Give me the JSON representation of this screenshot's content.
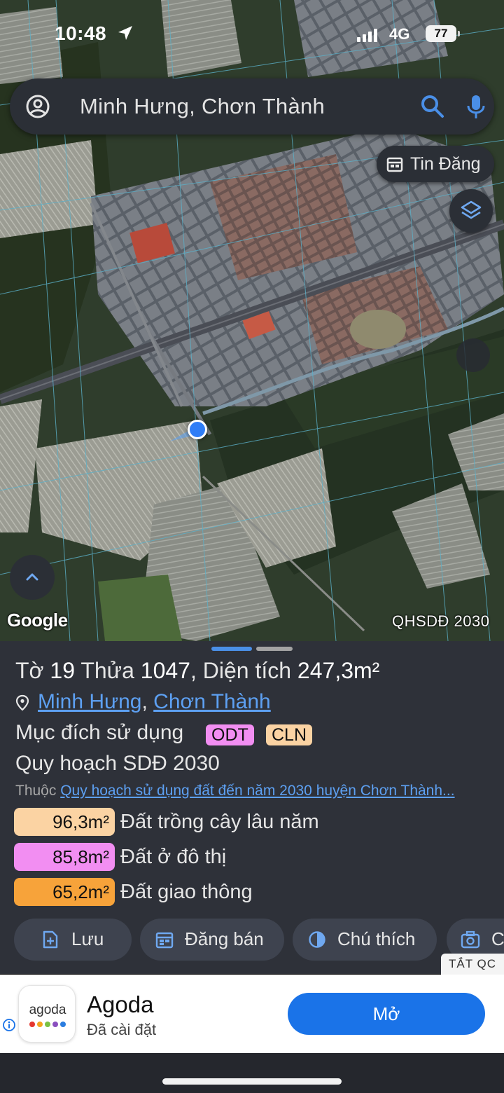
{
  "status_bar": {
    "time": "10:48",
    "network": "4G",
    "battery": "77"
  },
  "search": {
    "query": "Minh Hưng, Chơn Thành"
  },
  "map": {
    "tin_dang_label": "Tin Đăng",
    "attribution": "Google",
    "plan_label": "QHSDĐ 2030"
  },
  "parcel": {
    "title_prefix": "Tờ",
    "sheet_no": "19",
    "plot_word": "Thửa",
    "plot_no": "1047",
    "area_word": ", Diện tích",
    "area": "247,3m²",
    "ward": "Minh Hưng",
    "separator": ",",
    "district": "Chơn Thành",
    "purpose_label": "Mục đích sử dụng",
    "purpose_tags": [
      "ODT",
      "CLN"
    ],
    "plan_title": "Quy hoạch SDĐ 2030",
    "belongs_prefix": "Thuộc",
    "belongs_link": "Quy hoạch sử dụng đất đến năm 2030 huyện Chơn Thành...",
    "areas": [
      {
        "value": "96,3m²",
        "label": "Đất trồng cây lâu năm",
        "color": "#fbd3a3"
      },
      {
        "value": "85,8m²",
        "label": "Đất ở đô thị",
        "color": "#f28ef2"
      },
      {
        "value": "65,2m²",
        "label": "Đất giao thông",
        "color": "#f7a33a"
      }
    ]
  },
  "actions": {
    "save": "Lưu",
    "sell": "Đăng bán",
    "legend": "Chú thích",
    "photo": "C"
  },
  "ad": {
    "close_label": "TẮT QC",
    "app_icon_word": "agoda",
    "app_name": "Agoda",
    "status": "Đã cài đặt",
    "open_label": "Mở"
  },
  "colors": {
    "accent": "#1a73e8",
    "link": "#5da0f2",
    "sheet_bg": "#2e3139"
  },
  "icons": [
    "location-arrow-icon",
    "account-icon",
    "search-icon",
    "mic-icon",
    "calendar-icon",
    "layers-icon",
    "chevron-up-icon",
    "pin-icon",
    "save-icon",
    "sell-icon",
    "legend-icon",
    "camera-icon",
    "info-icon"
  ]
}
